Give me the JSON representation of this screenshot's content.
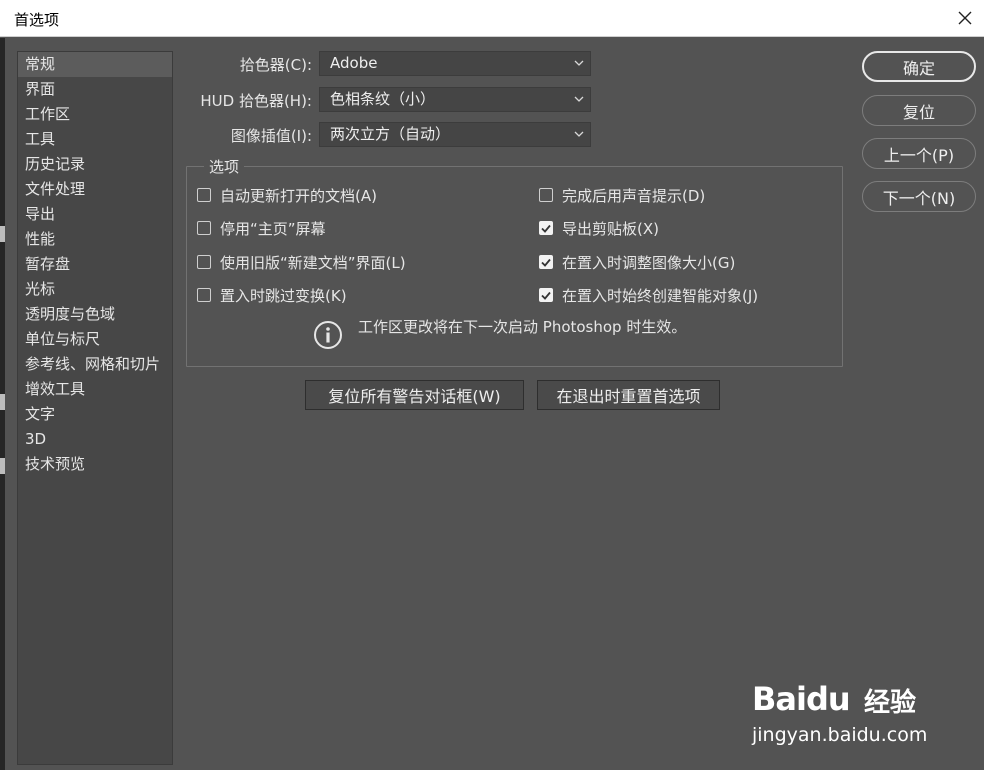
{
  "window": {
    "title": "首选项"
  },
  "sidebar": {
    "items": [
      {
        "label": "常规",
        "active": true
      },
      {
        "label": "界面"
      },
      {
        "label": "工作区"
      },
      {
        "label": "工具"
      },
      {
        "label": "历史记录"
      },
      {
        "label": "文件处理"
      },
      {
        "label": "导出"
      },
      {
        "label": "性能"
      },
      {
        "label": "暂存盘"
      },
      {
        "label": "光标"
      },
      {
        "label": "透明度与色域"
      },
      {
        "label": "单位与标尺"
      },
      {
        "label": "参考线、网格和切片"
      },
      {
        "label": "增效工具"
      },
      {
        "label": "文字"
      },
      {
        "label": "3D"
      },
      {
        "label": "技术预览"
      }
    ]
  },
  "fields": {
    "color_picker": {
      "label": "拾色器(C):",
      "value": "Adobe"
    },
    "hud_color_picker": {
      "label": "HUD 拾色器(H):",
      "value": "色相条纹（小）"
    },
    "image_interpolation": {
      "label": "图像插值(I):",
      "value": "两次立方（自动）"
    }
  },
  "options": {
    "legend": "选项",
    "checkboxes": [
      {
        "label": "自动更新打开的文档(A)",
        "checked": false
      },
      {
        "label": "完成后用声音提示(D)",
        "checked": false
      },
      {
        "label": "停用“主页”屏幕",
        "checked": false
      },
      {
        "label": "导出剪贴板(X)",
        "checked": true
      },
      {
        "label": "使用旧版“新建文档”界面(L)",
        "checked": false
      },
      {
        "label": "在置入时调整图像大小(G)",
        "checked": true
      },
      {
        "label": "置入时跳过变换(K)",
        "checked": false
      },
      {
        "label": "在置入时始终创建智能对象(J)",
        "checked": true
      }
    ],
    "info": "工作区更改将在下一次启动 Photoshop 时生效。"
  },
  "actions": {
    "reset_warnings": "复位所有警告对话框(W)",
    "reset_on_quit": "在退出时重置首选项"
  },
  "side_buttons": {
    "ok": "确定",
    "reset": "复位",
    "prev": "上一个(P)",
    "next": "下一个(N)"
  },
  "watermark": {
    "brand": "Baidu",
    "cn": "经验",
    "url": "jingyan.baidu.com"
  },
  "colors": {
    "background": "#535353",
    "panel": "#474747",
    "text": "#e6e6e6"
  }
}
